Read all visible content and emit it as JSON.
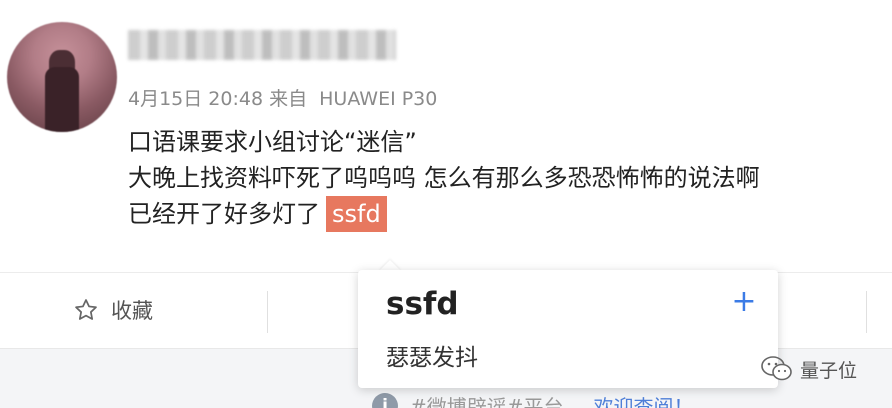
{
  "post": {
    "time": "4月15日 20:48",
    "source_prefix": "来自",
    "device": "HUAWEI P30",
    "lines": [
      "口语课要求小组讨论“迷信”",
      "大晚上找资料吓死了呜呜呜 怎么有那么多恐恐怖怖的说法啊",
      "已经开了好多灯了"
    ],
    "selected_word": "ssfd"
  },
  "actions": {
    "favorite_label": "收藏"
  },
  "popup": {
    "word": "ssfd",
    "add_symbol": "+",
    "definition": "瑟瑟发抖"
  },
  "notice": {
    "icon": "i",
    "text": "#微博辟谣#平台，",
    "link": "欢迎查阅！"
  },
  "watermark": {
    "text": "量子位"
  },
  "colors": {
    "highlight": "#e7785f",
    "accent_blue": "#3b7be6",
    "link": "#4e7fd8"
  }
}
